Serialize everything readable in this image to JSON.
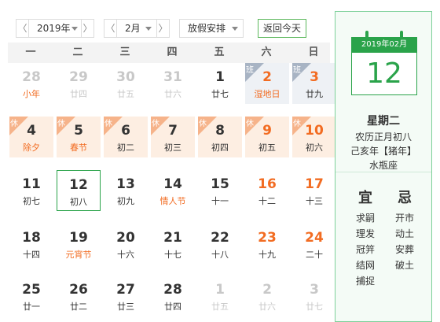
{
  "toolbar": {
    "prev_year": "〈",
    "year": "2019年",
    "next_year": "〉",
    "prev_month": "〈",
    "month": "2月",
    "next_month": "〉",
    "holiday": "放假安排",
    "today": "返回今天"
  },
  "weekdays": [
    "一",
    "二",
    "三",
    "四",
    "五",
    "六",
    "日"
  ],
  "weeks": [
    [
      {
        "d": "28",
        "l": "小年",
        "other": true,
        "festival": true
      },
      {
        "d": "29",
        "l": "廿四",
        "other": true
      },
      {
        "d": "30",
        "l": "廿五",
        "other": true
      },
      {
        "d": "31",
        "l": "廿六",
        "other": true
      },
      {
        "d": "1",
        "l": "廿七"
      },
      {
        "d": "2",
        "l": "湿地日",
        "tag": "班",
        "red": true,
        "festival": true
      },
      {
        "d": "3",
        "l": "廿九",
        "tag": "班",
        "red": true
      }
    ],
    [
      {
        "d": "4",
        "l": "除夕",
        "tag": "休",
        "festival": true
      },
      {
        "d": "5",
        "l": "春节",
        "tag": "休",
        "festival": true
      },
      {
        "d": "6",
        "l": "初二",
        "tag": "休"
      },
      {
        "d": "7",
        "l": "初三",
        "tag": "休"
      },
      {
        "d": "8",
        "l": "初四",
        "tag": "休"
      },
      {
        "d": "9",
        "l": "初五",
        "tag": "休",
        "red": true
      },
      {
        "d": "10",
        "l": "初六",
        "tag": "休",
        "red": true
      }
    ],
    [
      {
        "d": "11",
        "l": "初七"
      },
      {
        "d": "12",
        "l": "初八",
        "selected": true
      },
      {
        "d": "13",
        "l": "初九"
      },
      {
        "d": "14",
        "l": "情人节",
        "festival": true
      },
      {
        "d": "15",
        "l": "十一"
      },
      {
        "d": "16",
        "l": "十二",
        "red": true
      },
      {
        "d": "17",
        "l": "十三",
        "red": true
      }
    ],
    [
      {
        "d": "18",
        "l": "十四"
      },
      {
        "d": "19",
        "l": "元宵节",
        "festival": true
      },
      {
        "d": "20",
        "l": "十六"
      },
      {
        "d": "21",
        "l": "十七"
      },
      {
        "d": "22",
        "l": "十八"
      },
      {
        "d": "23",
        "l": "十九",
        "red": true
      },
      {
        "d": "24",
        "l": "二十",
        "red": true
      }
    ],
    [
      {
        "d": "25",
        "l": "廿一"
      },
      {
        "d": "26",
        "l": "廿二"
      },
      {
        "d": "27",
        "l": "廿三"
      },
      {
        "d": "28",
        "l": "廿四"
      },
      {
        "d": "1",
        "l": "廿五",
        "other": true
      },
      {
        "d": "2",
        "l": "廿六",
        "other": true
      },
      {
        "d": "3",
        "l": "廿七",
        "other": true
      }
    ]
  ],
  "panel": {
    "month_label": "2019年02月",
    "day": "12",
    "weekday": "星期二",
    "lunar": "农历正月初八",
    "ganzhi": "己亥年【猪年】",
    "zodiac": "水瓶座",
    "yi_title": "宜",
    "ji_title": "忌",
    "yi": [
      "求嗣",
      "理发",
      "冠笄",
      "结网",
      "捕捉"
    ],
    "ji": [
      "开市",
      "动土",
      "安葬",
      "破土"
    ]
  },
  "colors": {
    "accent": "#2aa34a",
    "holiday_orange": "#f26c22",
    "off_bg": "#fdeee2",
    "work_bg": "#eef1f5"
  }
}
